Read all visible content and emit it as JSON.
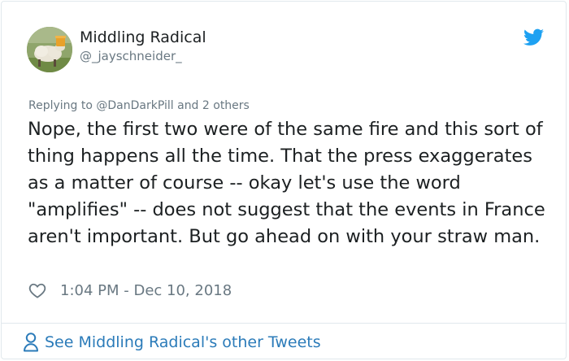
{
  "tweet": {
    "author_name": "Middling Radical",
    "author_handle": "@_jayschneider_",
    "reply_prefix": "Replying to",
    "reply_mention": "@DanDarkPill",
    "reply_suffix": "and 2 others",
    "text": "Nope, the first two were of the same fire and this sort of thing happens all the time. That the press exaggerates as a matter of course -- okay let's use the word \"amplifies\" -- does not suggest that the events in France aren't important. But go ahead on with your straw man.",
    "timestamp": "1:04 PM - Dec 10, 2018"
  },
  "footer": {
    "link_text": "See Middling Radical's other Tweets"
  },
  "icons": {
    "brand": "twitter-bird-icon",
    "like": "heart-outline-icon",
    "profile": "person-outline-icon"
  },
  "colors": {
    "brand_blue": "#1da1f2",
    "link_blue": "#2b7bb9",
    "secondary_text": "#697882",
    "primary_text": "#1c2022",
    "border": "#e1e8ed"
  }
}
